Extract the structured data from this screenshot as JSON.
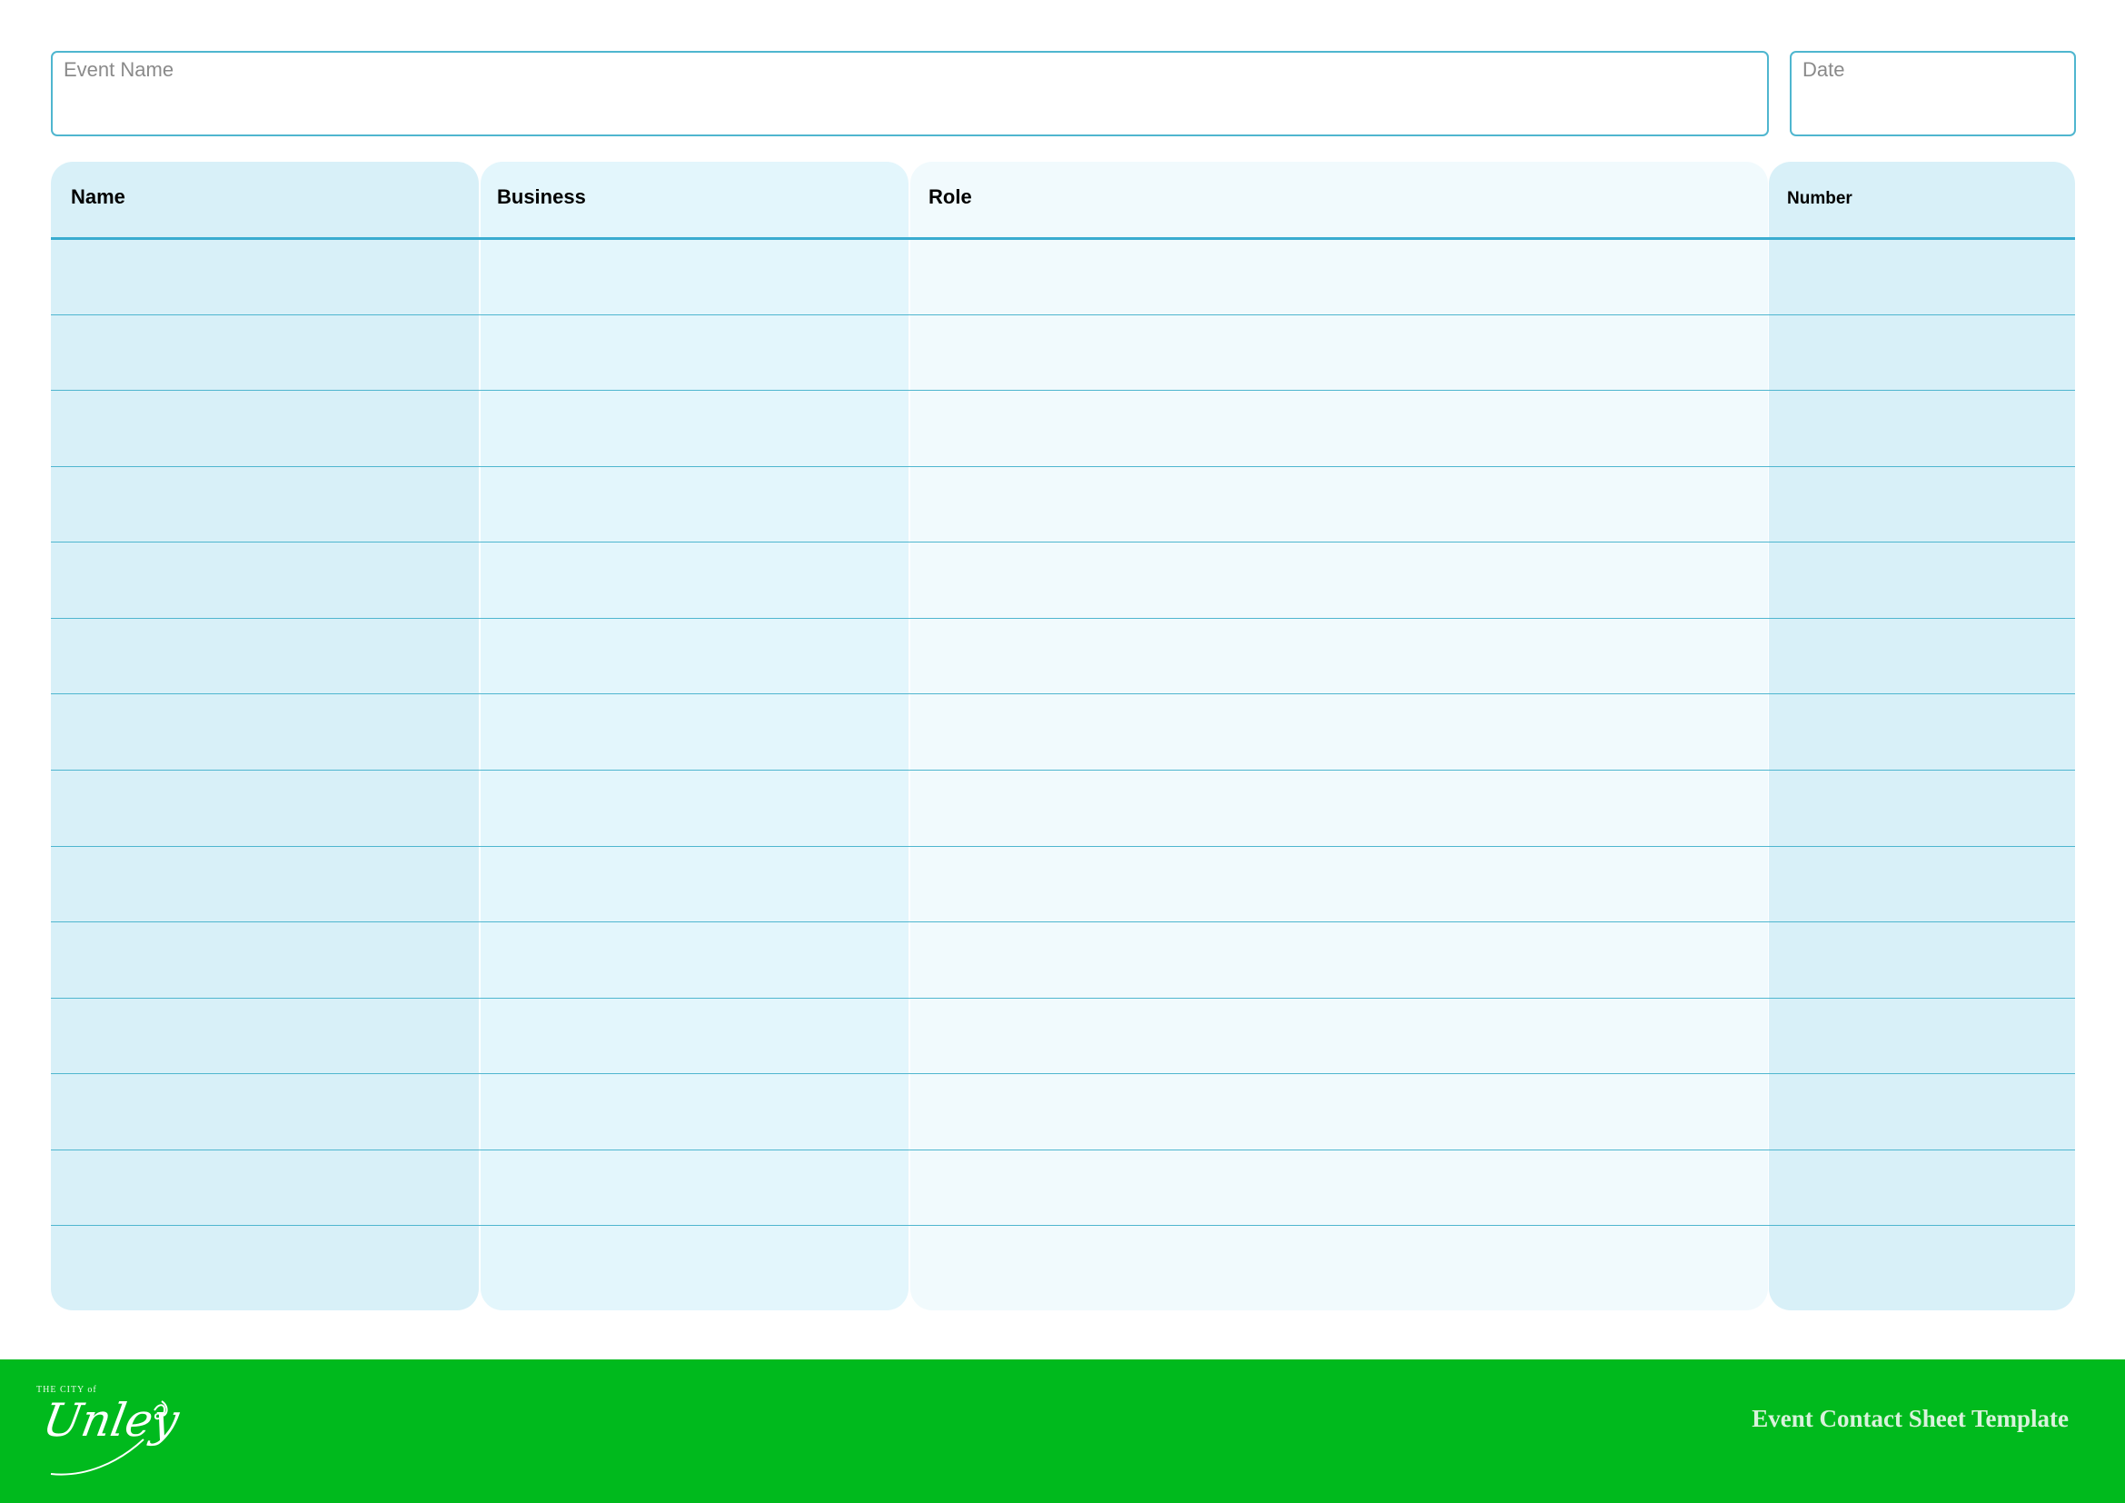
{
  "form": {
    "event_name_label": "Event Name",
    "date_label": "Date"
  },
  "table": {
    "columns": [
      "Name",
      "Business",
      "Role",
      "Number"
    ],
    "blank_rows": 14
  },
  "footer": {
    "logo_small_text": "THE CITY of",
    "logo_script_text": "Unley",
    "title": "Event Contact Sheet Template",
    "background_color": "#00ba1d"
  },
  "colors": {
    "accent_line": "#4fb6cf",
    "name_col": "#d8f0f8",
    "business_col": "#e3f6fc",
    "role_col": "#f1fafd",
    "number_col": "#d8f0f8"
  }
}
